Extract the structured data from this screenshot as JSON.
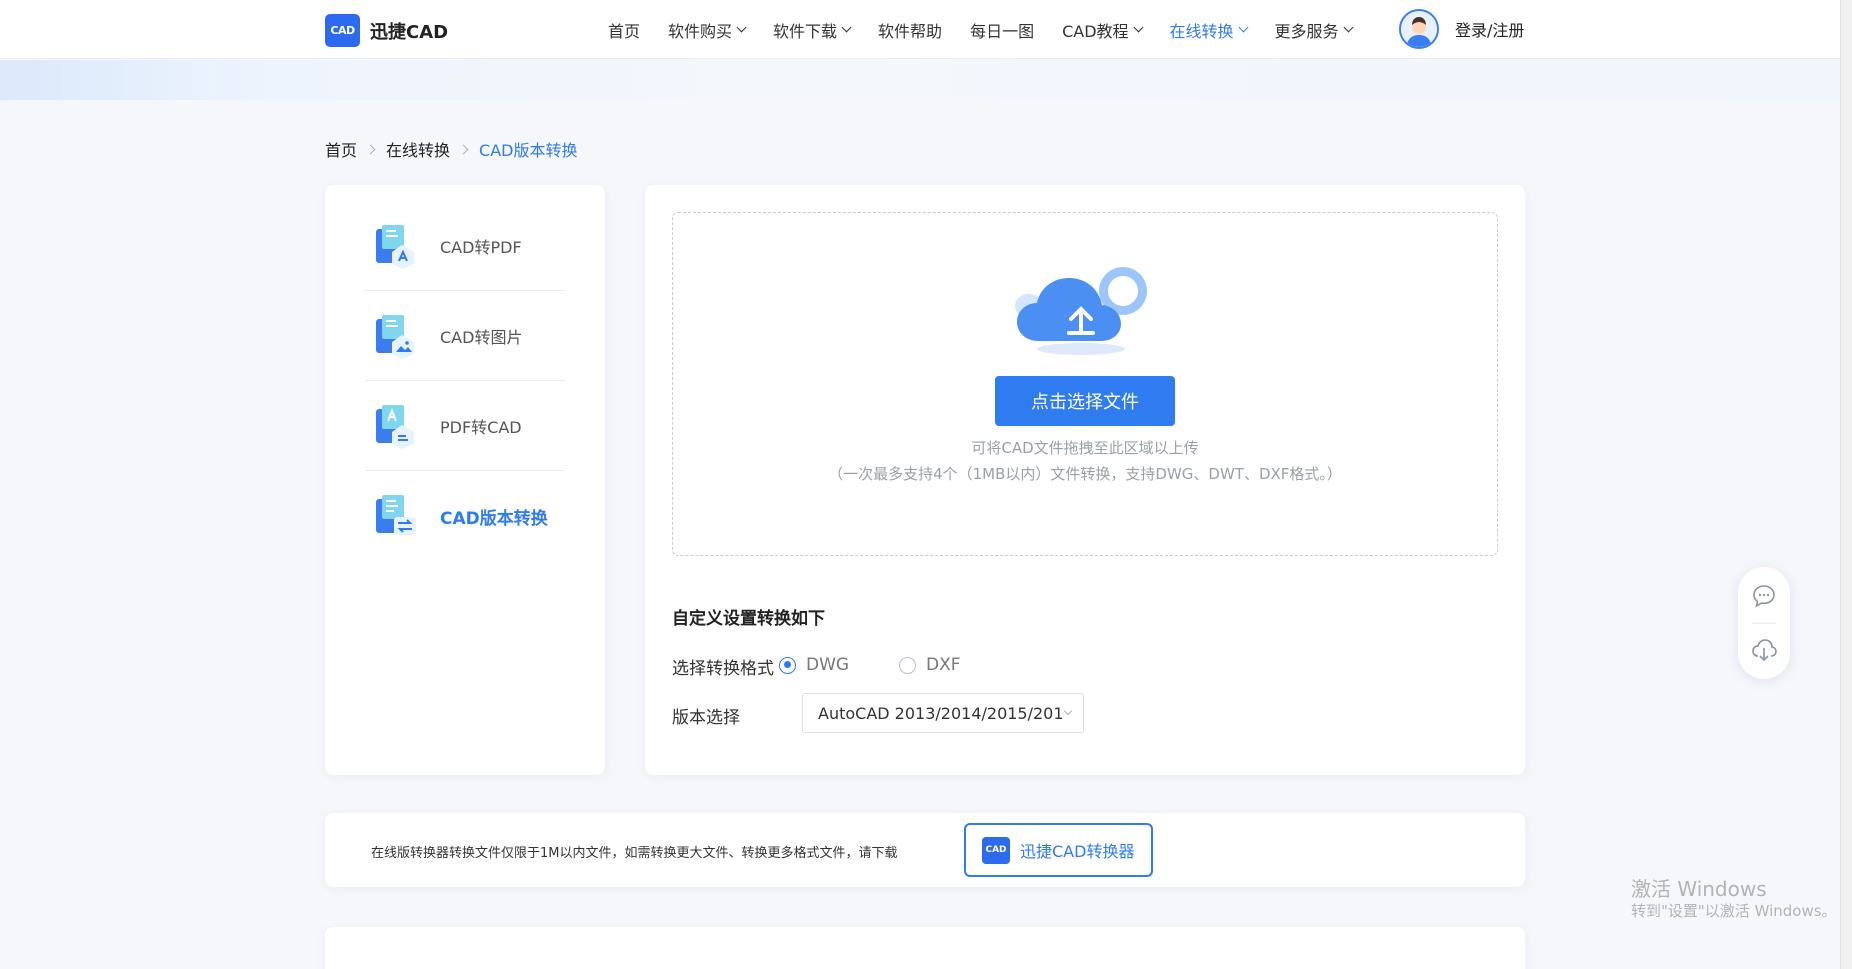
{
  "header": {
    "logo_mark": "CAD",
    "logo_text": "迅捷CAD",
    "nav": [
      {
        "label": "首页",
        "dropdown": false
      },
      {
        "label": "软件购买",
        "dropdown": true
      },
      {
        "label": "软件下载",
        "dropdown": true
      },
      {
        "label": "软件帮助",
        "dropdown": false
      },
      {
        "label": "每日一图",
        "dropdown": false
      },
      {
        "label": "CAD教程",
        "dropdown": true
      },
      {
        "label": "在线转换",
        "dropdown": true,
        "active": true
      },
      {
        "label": "更多服务",
        "dropdown": true
      }
    ],
    "login_label": "登录/注册"
  },
  "breadcrumb": {
    "items": [
      "首页",
      "在线转换"
    ],
    "current": "CAD版本转换"
  },
  "sidebar": {
    "items": [
      {
        "label": "CAD转PDF",
        "icon": "cad-to-pdf-icon",
        "active": false
      },
      {
        "label": "CAD转图片",
        "icon": "cad-to-image-icon",
        "active": false
      },
      {
        "label": "PDF转CAD",
        "icon": "pdf-to-cad-icon",
        "active": false
      },
      {
        "label": "CAD版本转换",
        "icon": "cad-version-convert-icon",
        "active": true
      }
    ]
  },
  "upload": {
    "button_label": "点击选择文件",
    "hint_line1": "可将CAD文件拖拽至此区域以上传",
    "hint_line2": "（一次最多支持4个（1MB以内）文件转换，支持DWG、DWT、DXF格式。）"
  },
  "settings": {
    "title": "自定义设置转换如下",
    "format_label": "选择转换格式",
    "formats": [
      {
        "label": "DWG",
        "checked": true
      },
      {
        "label": "DXF",
        "checked": false
      }
    ],
    "version_label": "版本选择",
    "version_value": "AutoCAD 2013/2014/2015/201"
  },
  "notice": {
    "text": "在线版转换器转换文件仅限于1M以内文件，如需转换更大文件、转换更多格式文件，请下载",
    "download_icon_text": "CAD",
    "download_label": "迅捷CAD转换器"
  },
  "float_tools": [
    "chat-icon",
    "cloud-download-icon"
  ],
  "watermark": {
    "line1": "激活 Windows",
    "line2": "转到\"设置\"以激活 Windows。"
  },
  "colors": {
    "accent": "#2f7bf0",
    "logo_blue": "#2c6bef",
    "page_bg": "#f5f7fb"
  }
}
